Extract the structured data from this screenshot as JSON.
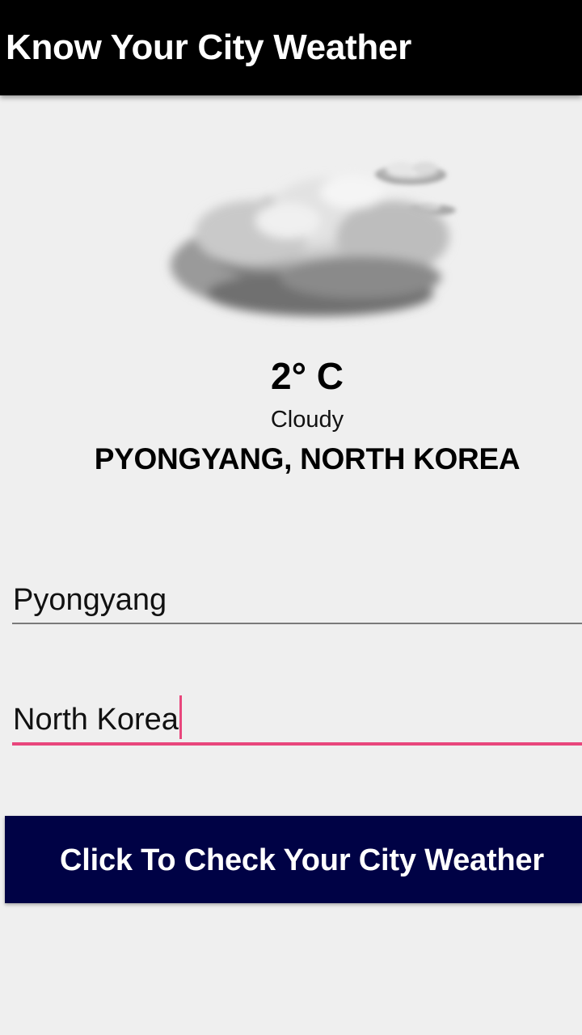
{
  "app_bar": {
    "title": "Know Your City Weather",
    "background": "#000000"
  },
  "weather": {
    "icon": "cloudy-cloud-icon",
    "temperature": "2° C",
    "condition": "Cloudy",
    "location": "PYONGYANG, NORTH KOREA"
  },
  "form": {
    "city_value": "Pyongyang",
    "country_value": "North Korea",
    "focus_color": "#e8467c"
  },
  "button": {
    "label": "Click To Check Your City Weather",
    "background": "#000245"
  }
}
